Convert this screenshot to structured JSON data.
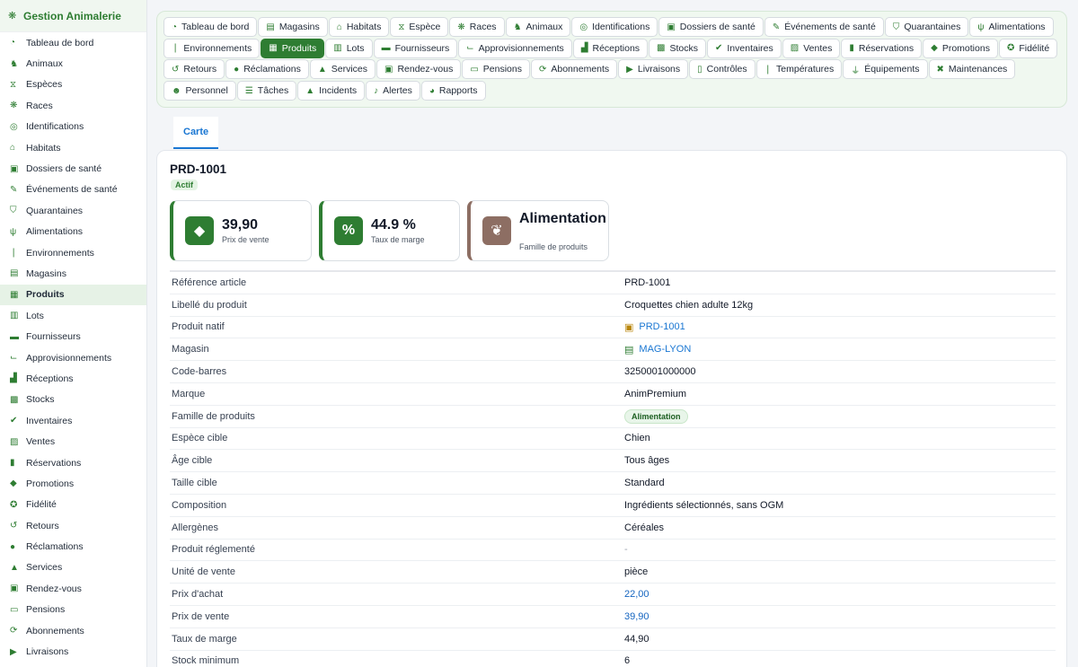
{
  "app": {
    "title": "Gestion Animalerie"
  },
  "sidebar": {
    "items": [
      {
        "label": "Tableau de bord",
        "icon": "dashboard-icon"
      },
      {
        "label": "Animaux",
        "icon": "dog-icon"
      },
      {
        "label": "Espèces",
        "icon": "dna-icon"
      },
      {
        "label": "Races",
        "icon": "paw-icon"
      },
      {
        "label": "Identifications",
        "icon": "fingerprint-icon"
      },
      {
        "label": "Habitats",
        "icon": "house-icon"
      },
      {
        "label": "Dossiers de santé",
        "icon": "file-medical-icon"
      },
      {
        "label": "Événements de santé",
        "icon": "syringe-icon"
      },
      {
        "label": "Quarantaines",
        "icon": "shield-icon"
      },
      {
        "label": "Alimentations",
        "icon": "utensils-icon"
      },
      {
        "label": "Environnements",
        "icon": "thermometer-icon"
      },
      {
        "label": "Magasins",
        "icon": "store-icon"
      },
      {
        "label": "Produits",
        "icon": "box-icon"
      },
      {
        "label": "Lots",
        "icon": "barcode-icon"
      },
      {
        "label": "Fournisseurs",
        "icon": "truck-icon"
      },
      {
        "label": "Approvisionnements",
        "icon": "dolly-icon"
      },
      {
        "label": "Réceptions",
        "icon": "truck-loading-icon"
      },
      {
        "label": "Stocks",
        "icon": "warehouse-icon"
      },
      {
        "label": "Inventaires",
        "icon": "clipboard-check-icon"
      },
      {
        "label": "Ventes",
        "icon": "cash-register-icon"
      },
      {
        "label": "Réservations",
        "icon": "bookmark-icon"
      },
      {
        "label": "Promotions",
        "icon": "tags-icon"
      },
      {
        "label": "Fidélité",
        "icon": "award-icon"
      },
      {
        "label": "Retours",
        "icon": "undo-icon"
      },
      {
        "label": "Réclamations",
        "icon": "comment-icon"
      },
      {
        "label": "Services",
        "icon": "bell-concierge-icon"
      },
      {
        "label": "Rendez-vous",
        "icon": "calendar-check-icon"
      },
      {
        "label": "Pensions",
        "icon": "bed-icon"
      },
      {
        "label": "Abonnements",
        "icon": "sync-icon"
      },
      {
        "label": "Livraisons",
        "icon": "truck-fast-icon"
      }
    ],
    "active_index": 12
  },
  "topnav": {
    "items": [
      {
        "label": "Tableau de bord",
        "icon": "dashboard-icon"
      },
      {
        "label": "Magasins",
        "icon": "store-icon"
      },
      {
        "label": "Habitats",
        "icon": "house-icon"
      },
      {
        "label": "Espèce",
        "icon": "dna-icon"
      },
      {
        "label": "Races",
        "icon": "paw-icon"
      },
      {
        "label": "Animaux",
        "icon": "dog-icon"
      },
      {
        "label": "Identifications",
        "icon": "fingerprint-icon"
      },
      {
        "label": "Dossiers de santé",
        "icon": "file-medical-icon"
      },
      {
        "label": "Événements de santé",
        "icon": "syringe-icon"
      },
      {
        "label": "Quarantaines",
        "icon": "shield-icon"
      },
      {
        "label": "Alimentations",
        "icon": "utensils-icon"
      },
      {
        "label": "Environnements",
        "icon": "thermometer-icon"
      },
      {
        "label": "Produits",
        "icon": "box-icon"
      },
      {
        "label": "Lots",
        "icon": "barcode-icon"
      },
      {
        "label": "Fournisseurs",
        "icon": "truck-icon"
      },
      {
        "label": "Approvisionnements",
        "icon": "dolly-icon"
      },
      {
        "label": "Réceptions",
        "icon": "truck-loading-icon"
      },
      {
        "label": "Stocks",
        "icon": "warehouse-icon"
      },
      {
        "label": "Inventaires",
        "icon": "clipboard-check-icon"
      },
      {
        "label": "Ventes",
        "icon": "cash-register-icon"
      },
      {
        "label": "Réservations",
        "icon": "bookmark-icon"
      },
      {
        "label": "Promotions",
        "icon": "tags-icon"
      },
      {
        "label": "Fidélité",
        "icon": "award-icon"
      },
      {
        "label": "Retours",
        "icon": "undo-icon"
      },
      {
        "label": "Réclamations",
        "icon": "comment-icon"
      },
      {
        "label": "Services",
        "icon": "bell-concierge-icon"
      },
      {
        "label": "Rendez-vous",
        "icon": "calendar-check-icon"
      },
      {
        "label": "Pensions",
        "icon": "bed-icon"
      },
      {
        "label": "Abonnements",
        "icon": "sync-icon"
      },
      {
        "label": "Livraisons",
        "icon": "truck-fast-icon"
      },
      {
        "label": "Contrôles",
        "icon": "clipboard-icon"
      },
      {
        "label": "Températures",
        "icon": "thermometer-icon"
      },
      {
        "label": "Équipements",
        "icon": "plug-icon"
      },
      {
        "label": "Maintenances",
        "icon": "tools-icon"
      },
      {
        "label": "Personnel",
        "icon": "users-icon"
      },
      {
        "label": "Tâches",
        "icon": "tasks-icon"
      },
      {
        "label": "Incidents",
        "icon": "warning-icon"
      },
      {
        "label": "Alertes",
        "icon": "bell-icon"
      },
      {
        "label": "Rapports",
        "icon": "chart-pie-icon"
      }
    ],
    "active_index": 12
  },
  "tabs": [
    {
      "label": "Carte"
    }
  ],
  "record": {
    "id": "PRD-1001",
    "status": "Actif",
    "kpis": [
      {
        "value": "39,90",
        "label": "Prix de vente",
        "icon": "tag-icon",
        "color": "#2e7d32"
      },
      {
        "value": "44.9 %",
        "label": "Taux de marge",
        "icon": "percent-icon",
        "color": "#2e7d32"
      },
      {
        "value": "Alimentation",
        "label": "Famille de produits",
        "icon": "leaf-icon",
        "color": "#8d6e63"
      }
    ],
    "fields": [
      {
        "label": "Référence article",
        "value": "PRD-1001",
        "type": "text"
      },
      {
        "label": "Libellé du produit",
        "value": "Croquettes chien adulte 12kg",
        "type": "text"
      },
      {
        "label": "Produit natif",
        "value": "PRD-1001",
        "type": "link",
        "icon": "box-icon"
      },
      {
        "label": "Magasin",
        "value": "MAG-LYON",
        "type": "link",
        "icon": "store-icon"
      },
      {
        "label": "Code-barres",
        "value": "3250001000000",
        "type": "text"
      },
      {
        "label": "Marque",
        "value": "AnimPremium",
        "type": "text"
      },
      {
        "label": "Famille de produits",
        "value": "Alimentation",
        "type": "pill"
      },
      {
        "label": "Espèce cible",
        "value": "Chien",
        "type": "text"
      },
      {
        "label": "Âge cible",
        "value": "Tous âges",
        "type": "text"
      },
      {
        "label": "Taille cible",
        "value": "Standard",
        "type": "text"
      },
      {
        "label": "Composition",
        "value": "Ingrédients sélectionnés, sans OGM",
        "type": "text"
      },
      {
        "label": "Allergènes",
        "value": "Céréales",
        "type": "text"
      },
      {
        "label": "Produit réglementé",
        "value": "-",
        "type": "muted"
      },
      {
        "label": "Unité de vente",
        "value": "pièce",
        "type": "text"
      },
      {
        "label": "Prix d'achat",
        "value": "22,00",
        "type": "num"
      },
      {
        "label": "Prix de vente",
        "value": "39,90",
        "type": "num"
      },
      {
        "label": "Taux de marge",
        "value": "44,90",
        "type": "text"
      },
      {
        "label": "Stock minimum",
        "value": "6",
        "type": "text"
      }
    ]
  },
  "colors": {
    "primary": "#2e7d32",
    "accent": "#1976d2",
    "brown": "#8d6e63"
  }
}
